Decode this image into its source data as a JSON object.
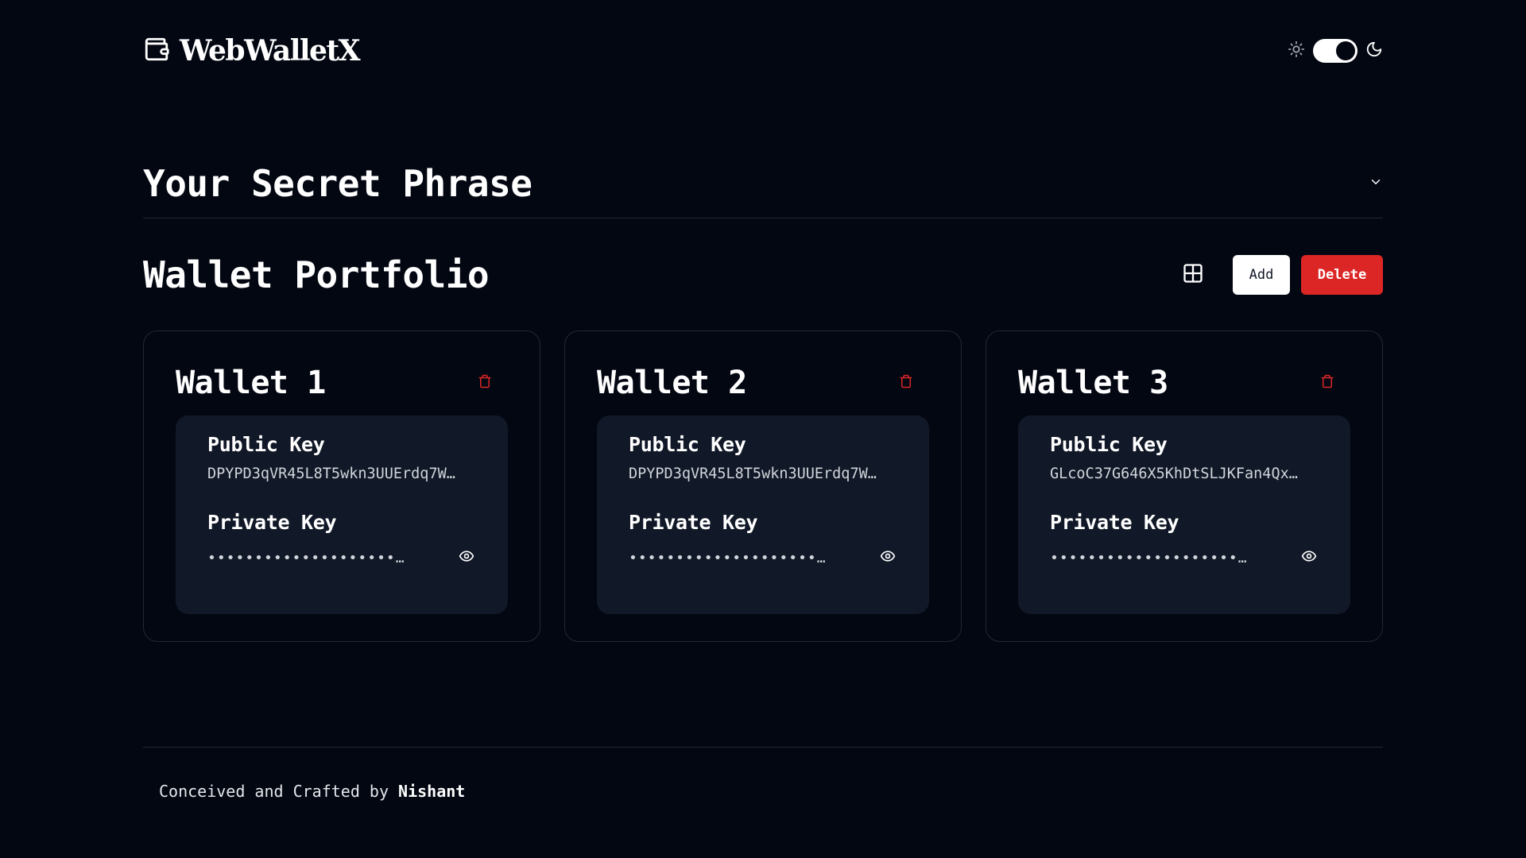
{
  "brand": {
    "icon": "wallet-icon",
    "name": "WebWalletX"
  },
  "theme_switch": {
    "light_icon": "sun-icon",
    "dark_icon": "moon-icon",
    "mode": "dark"
  },
  "secret_phrase": {
    "title": "Your Secret Phrase",
    "icon": "chevron-down-icon"
  },
  "portfolio": {
    "title": "Wallet Portfolio",
    "grid_icon": "grid-view-icon",
    "add_label": "Add",
    "delete_label": "Delete",
    "wallets": [
      {
        "title": "Wallet 1",
        "public_key_label": "Public Key",
        "public_key": "DPYPD3qVR45L8T5wkn3UUErdq7W…",
        "private_key_label": "Private Key",
        "private_key": "••••••••••••••••••••…"
      },
      {
        "title": "Wallet 2",
        "public_key_label": "Public Key",
        "public_key": "DPYPD3qVR45L8T5wkn3UUErdq7W…",
        "private_key_label": "Private Key",
        "private_key": "••••••••••••••••••••…"
      },
      {
        "title": "Wallet 3",
        "public_key_label": "Public Key",
        "public_key": "GLcoC37G646X5KhDtSLJKFan4Qx…",
        "private_key_label": "Private Key",
        "private_key": "••••••••••••••••••••…"
      }
    ]
  },
  "footer": {
    "prefix": "Conceived and Crafted by",
    "author": "Nishant"
  },
  "colors": {
    "background": "#030712",
    "card_inner": "#111827",
    "border": "#1f2937",
    "danger": "#dc2626"
  }
}
